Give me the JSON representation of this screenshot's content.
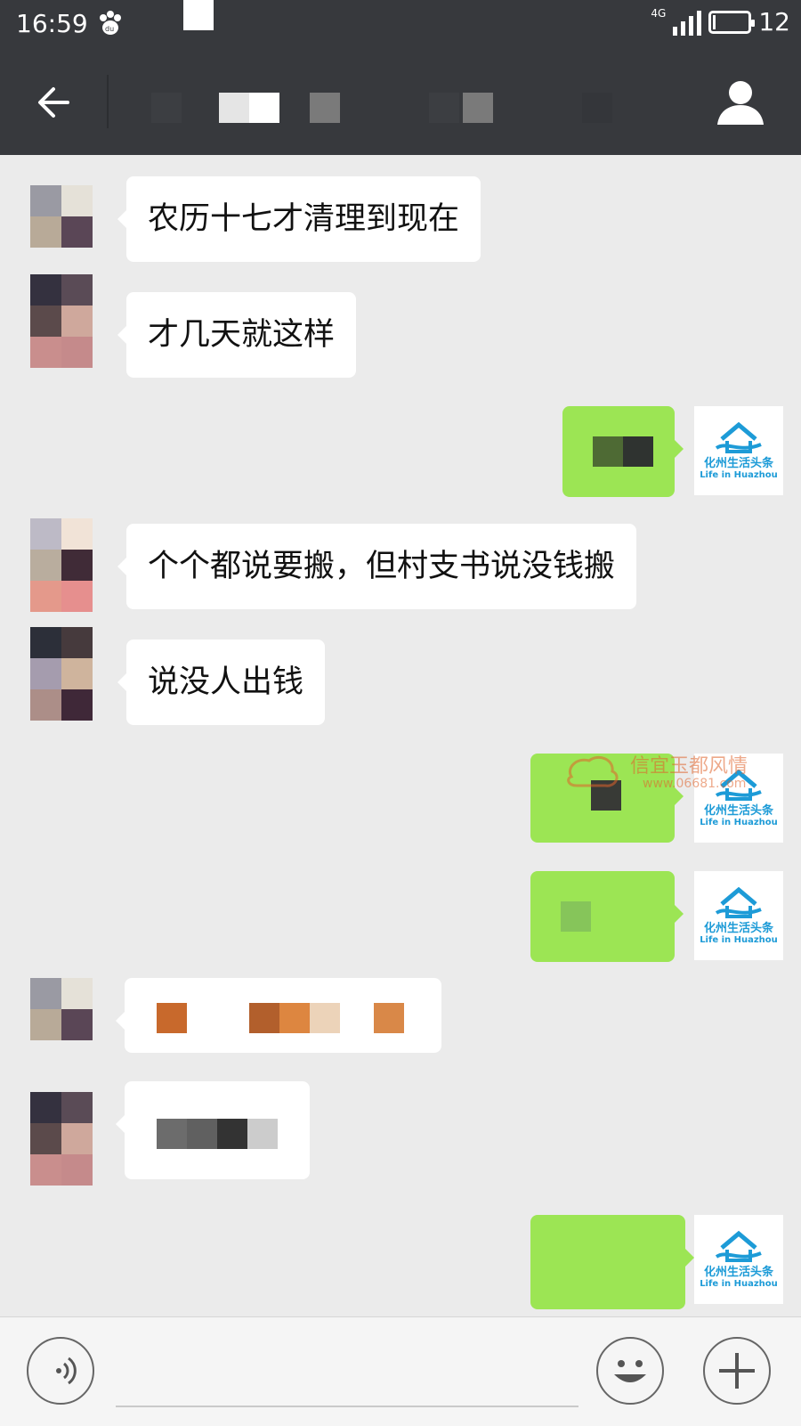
{
  "status_bar": {
    "time": "16:59",
    "network": "4G",
    "battery": "12",
    "icons": [
      "baidu-paw-icon",
      "signal-icon",
      "battery-icon"
    ]
  },
  "nav": {
    "back_icon": "back-arrow-icon",
    "person_icon": "person-icon"
  },
  "messages": [
    {
      "side": "in",
      "text": "农历十七才清理到现在"
    },
    {
      "side": "in",
      "text": "才几天就这样"
    },
    {
      "side": "out",
      "text": ""
    },
    {
      "side": "in",
      "text": "个个都说要搬，但村支书说没钱搬"
    },
    {
      "side": "in",
      "text": "说没人出钱"
    },
    {
      "side": "out",
      "text": ""
    },
    {
      "side": "out",
      "text": ""
    },
    {
      "side": "in",
      "text": ""
    },
    {
      "side": "in",
      "text": ""
    },
    {
      "side": "out",
      "text": ""
    }
  ],
  "brand_avatar": {
    "name_zh": "化州生活头条",
    "name_en": "Life in Huazhou"
  },
  "watermark": {
    "text": "信宜玉都风情",
    "url": "www.06681.com"
  },
  "input_bar": {
    "voice_icon": "voice-icon",
    "emoji_icon": "emoji-icon",
    "plus_icon": "plus-icon"
  },
  "colors": {
    "header_bg": "#37393d",
    "chat_bg": "#ebebeb",
    "bubble_out": "#9ce554",
    "bubble_in": "#ffffff",
    "brand_blue": "#1d9bd7"
  }
}
